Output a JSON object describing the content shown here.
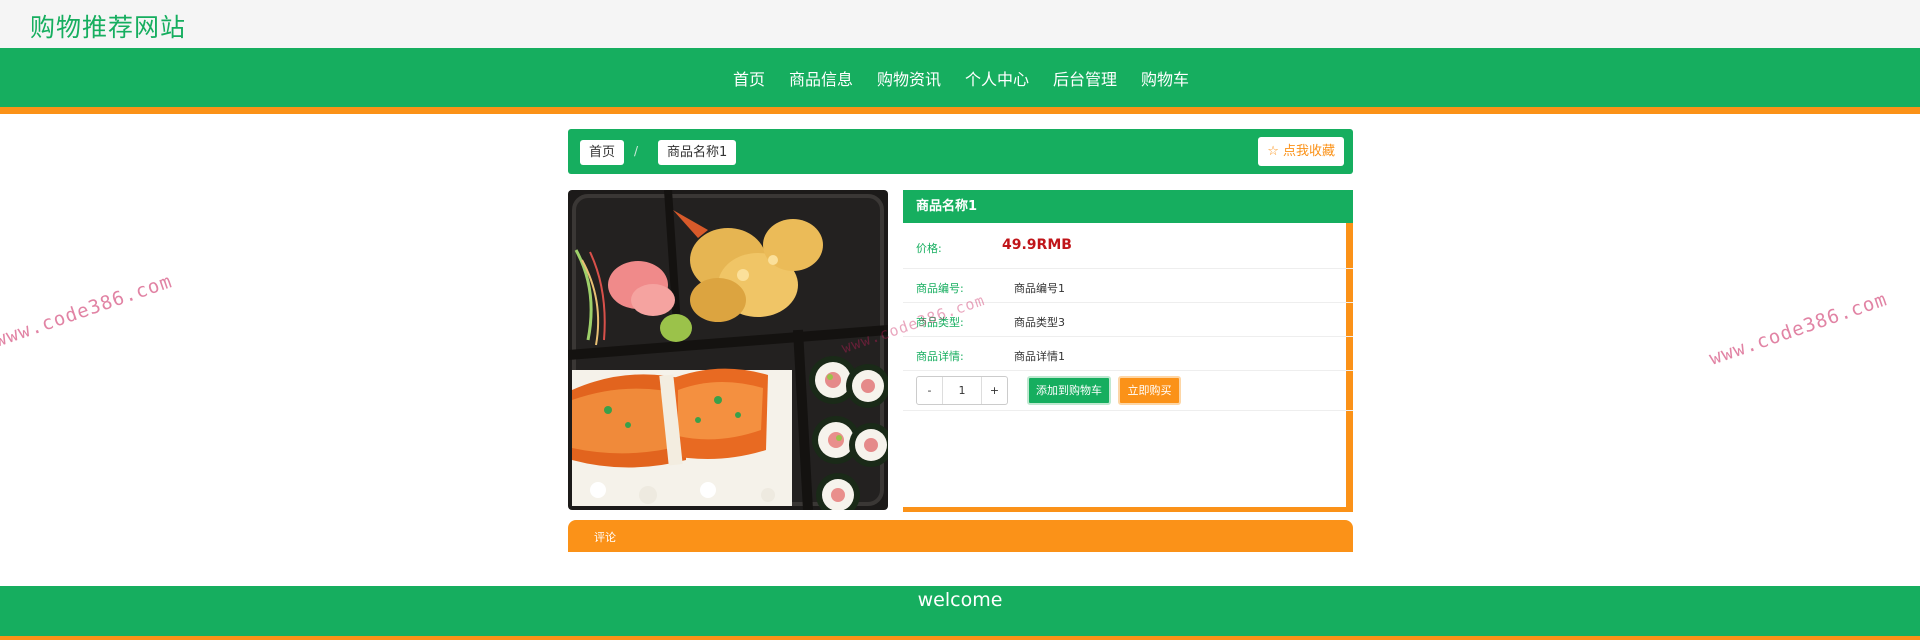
{
  "site": {
    "title": "购物推荐网站"
  },
  "nav": {
    "items": [
      "首页",
      "商品信息",
      "购物资讯",
      "个人中心",
      "后台管理",
      "购物车"
    ]
  },
  "breadcrumb": {
    "home": "首页",
    "separator": "/",
    "current": "商品名称1",
    "favorite": "☆ 点我收藏"
  },
  "product": {
    "name": "商品名称1",
    "price_label": "价格:",
    "price": "49.9RMB",
    "fields": [
      {
        "label": "商品编号:",
        "value": "商品编号1"
      },
      {
        "label": "商品类型:",
        "value": "商品类型3"
      },
      {
        "label": "商品详情:",
        "value": "商品详情1"
      }
    ],
    "quantity": {
      "minus": "-",
      "value": "1",
      "plus": "+"
    },
    "add_to_cart": "添加到购物车",
    "buy_now": "立即购买"
  },
  "comments": {
    "label": "评论"
  },
  "footer": {
    "text": "welcome"
  },
  "watermark": {
    "text": "www.code386.com"
  },
  "colors": {
    "primary": "#16ae5f",
    "accent": "#fb9218",
    "price": "#c0151a"
  }
}
